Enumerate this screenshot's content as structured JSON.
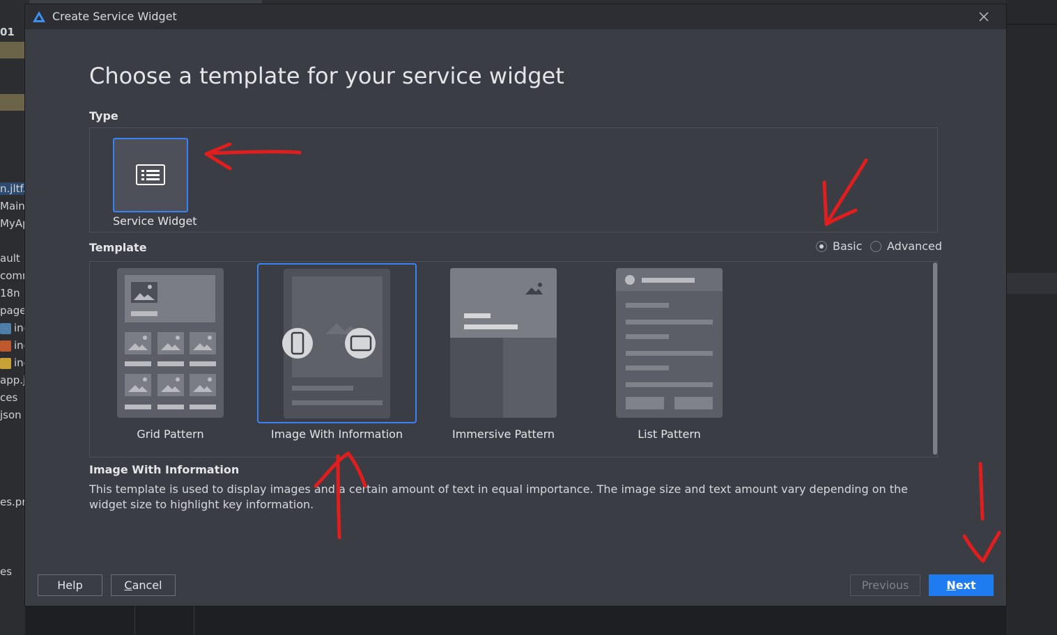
{
  "ide": {
    "left_items": [
      "01",
      "n.jltf.j",
      "Main/",
      "MyAp",
      "ault",
      "comn",
      "18n",
      "pages",
      "inc",
      "inc",
      "inc",
      "app.js",
      "ces",
      "json",
      "es.pr",
      "es"
    ]
  },
  "dialog": {
    "title": "Create Service Widget",
    "heading": "Choose a template for your service widget",
    "type": {
      "label": "Type",
      "cards": [
        {
          "label": "Service Widget",
          "selected": true
        }
      ]
    },
    "template": {
      "label": "Template",
      "mode_options": [
        {
          "label": "Basic",
          "checked": true
        },
        {
          "label": "Advanced",
          "checked": false
        }
      ],
      "cards": [
        {
          "label": "Grid Pattern",
          "selected": false
        },
        {
          "label": "Image With Information",
          "selected": true
        },
        {
          "label": "Immersive Pattern",
          "selected": false
        },
        {
          "label": "List Pattern",
          "selected": false
        }
      ]
    },
    "description": {
      "title": "Image With Information",
      "text": "This template is used to display images and a certain amount of text in equal importance. The image size and text amount vary depending on the widget size to highlight key information."
    },
    "buttons": {
      "help": "Help",
      "cancel_mnemonic": "C",
      "cancel_rest": "ancel",
      "previous": "Previous",
      "next_mnemonic": "N",
      "next_rest": "ext"
    }
  },
  "colors": {
    "accent": "#1f7cf0",
    "selection_border": "#3b82f6",
    "annotation": "#e01e1e",
    "dialog_bg": "#3a3d44"
  }
}
